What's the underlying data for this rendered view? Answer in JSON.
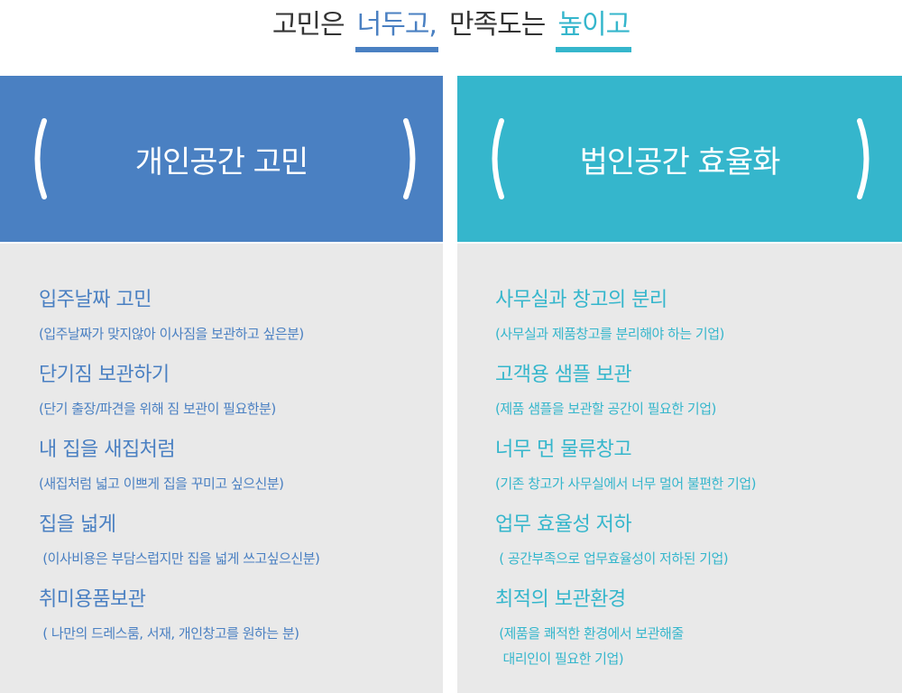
{
  "headline": {
    "part1": "고민은",
    "part2": "너두고,",
    "part3": "만족도는",
    "part4": "높이고"
  },
  "colors": {
    "blue": "#4a80c2",
    "teal": "#35b6cc",
    "panel": "#e9e9e9"
  },
  "left": {
    "title": "개인공간 고민",
    "items": [
      {
        "title": "입주날짜 고민",
        "sub": "(입주날짜가 맞지않아 이사짐을 보관하고 싶은분)"
      },
      {
        "title": "단기짐 보관하기",
        "sub": "(단기 출장/파견을 위해 짐 보관이 필요한분)"
      },
      {
        "title": "내 집을 새집처럼",
        "sub": "(새집처럼 넓고 이쁘게 집을 꾸미고 싶으신분)"
      },
      {
        "title": "집을 넓게",
        "sub": " (이사비용은 부담스럽지만 집을 넓게 쓰고싶으신분)"
      },
      {
        "title": "취미용품보관",
        "sub": " ( 나만의 드레스룸, 서재, 개인창고를 원하는 분)"
      }
    ]
  },
  "right": {
    "title": "법인공간 효율화",
    "items": [
      {
        "title": "사무실과 창고의 분리",
        "sub": "(사무실과 제품창고를 분리해야 하는 기업)"
      },
      {
        "title": "고객용 샘플 보관",
        "sub": "(제품 샘플을 보관할 공간이 필요한 기업)"
      },
      {
        "title": "너무 먼 물류창고",
        "sub": "(기존 창고가 사무실에서 너무 멀어 불편한 기업)"
      },
      {
        "title": "업무 효율성 저하",
        "sub": " ( 공간부족으로 업무효율성이 저하된 기업)"
      },
      {
        "title": "최적의 보관환경",
        "sub": " (제품을 쾌적한 환경에서 보관해줄",
        "sub2": "  대리인이 필요한 기업)"
      }
    ]
  }
}
